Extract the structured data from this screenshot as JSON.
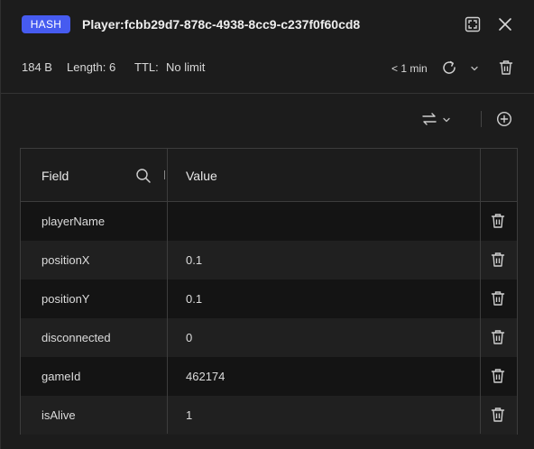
{
  "header": {
    "type_badge": "HASH",
    "key_name": "Player:fcbb29d7-878c-4938-8cc9-c237f0f60cd8"
  },
  "meta": {
    "size": "184 B",
    "length": "Length: 6",
    "ttl_label": "TTL:",
    "ttl_value": "No limit",
    "refresh_time": "< 1 min"
  },
  "table": {
    "columns": [
      "Field",
      "Value"
    ],
    "rows": [
      {
        "field": "playerName",
        "value": ""
      },
      {
        "field": "positionX",
        "value": "0.1"
      },
      {
        "field": "positionY",
        "value": "0.1"
      },
      {
        "field": "disconnected",
        "value": "0"
      },
      {
        "field": "gameId",
        "value": "462174"
      },
      {
        "field": "isAlive",
        "value": "1"
      }
    ]
  },
  "colors": {
    "accent": "#465bf0",
    "background": "#1c1c1c",
    "row_dark": "#141414",
    "row_light": "#202020"
  },
  "icons": [
    "fullscreen-icon",
    "close-icon",
    "refresh-icon",
    "chevron-down-icon",
    "trash-icon",
    "swap-icon",
    "plus-circle-icon",
    "search-icon"
  ]
}
